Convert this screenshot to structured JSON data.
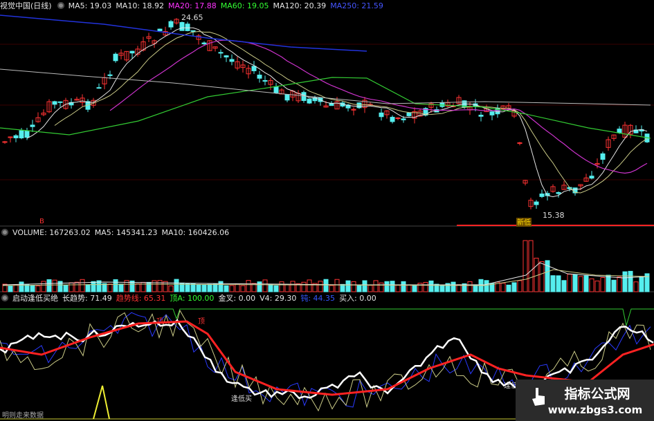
{
  "main": {
    "title": "视觉中国(日线)",
    "ma": [
      {
        "label": "MA5: 19.03",
        "color": "#e6e6e6"
      },
      {
        "label": "MA10: 18.92",
        "color": "#e6e6e6"
      },
      {
        "label": "MA20: 17.88",
        "color": "#ff33ff"
      },
      {
        "label": "MA60: 19.05",
        "color": "#33ff33"
      },
      {
        "label": "MA120: 20.39",
        "color": "#e6e6e6"
      },
      {
        "label": "MA250: 21.59",
        "color": "#3333ff"
      }
    ],
    "high_label": "24.65",
    "low_label": "15.38",
    "new_low_badge": "新低",
    "marker_text": "B"
  },
  "volume": {
    "ma": [
      {
        "label": "VOLUME: 167263.02",
        "color": "#e6e6e6"
      },
      {
        "label": "MA5: 145341.23",
        "color": "#e6e6e6"
      },
      {
        "label": "MA10: 160426.06",
        "color": "#e6e6e6"
      }
    ]
  },
  "indicator": {
    "name": "启动逢低买绝",
    "fields": [
      {
        "label": "长趋势: 71.49",
        "color": "#e6e6e6"
      },
      {
        "label": "趋势线: 65.31",
        "color": "#ff3333"
      },
      {
        "label": "顶A: 100.00",
        "color": "#33ff33"
      },
      {
        "label": "金叉: 0.00",
        "color": "#e6e6e6"
      },
      {
        "label": "V4: 29.30",
        "color": "#e6e6e6"
      },
      {
        "label": "钝: 44.35",
        "color": "#3355ff"
      },
      {
        "label": "买入: 0.00",
        "color": "#e6e6e6"
      }
    ],
    "tags": {
      "top1": "顶",
      "top2": "顶",
      "low": "逢低买",
      "low2": "逢低"
    },
    "footer": "明则走来数据"
  },
  "watermark": {
    "line1": "指标公式网",
    "line2": "www.zbgs3.com"
  },
  "colors": {
    "up": "#ff3333",
    "down": "#55eeee",
    "bg": "#000000"
  }
}
